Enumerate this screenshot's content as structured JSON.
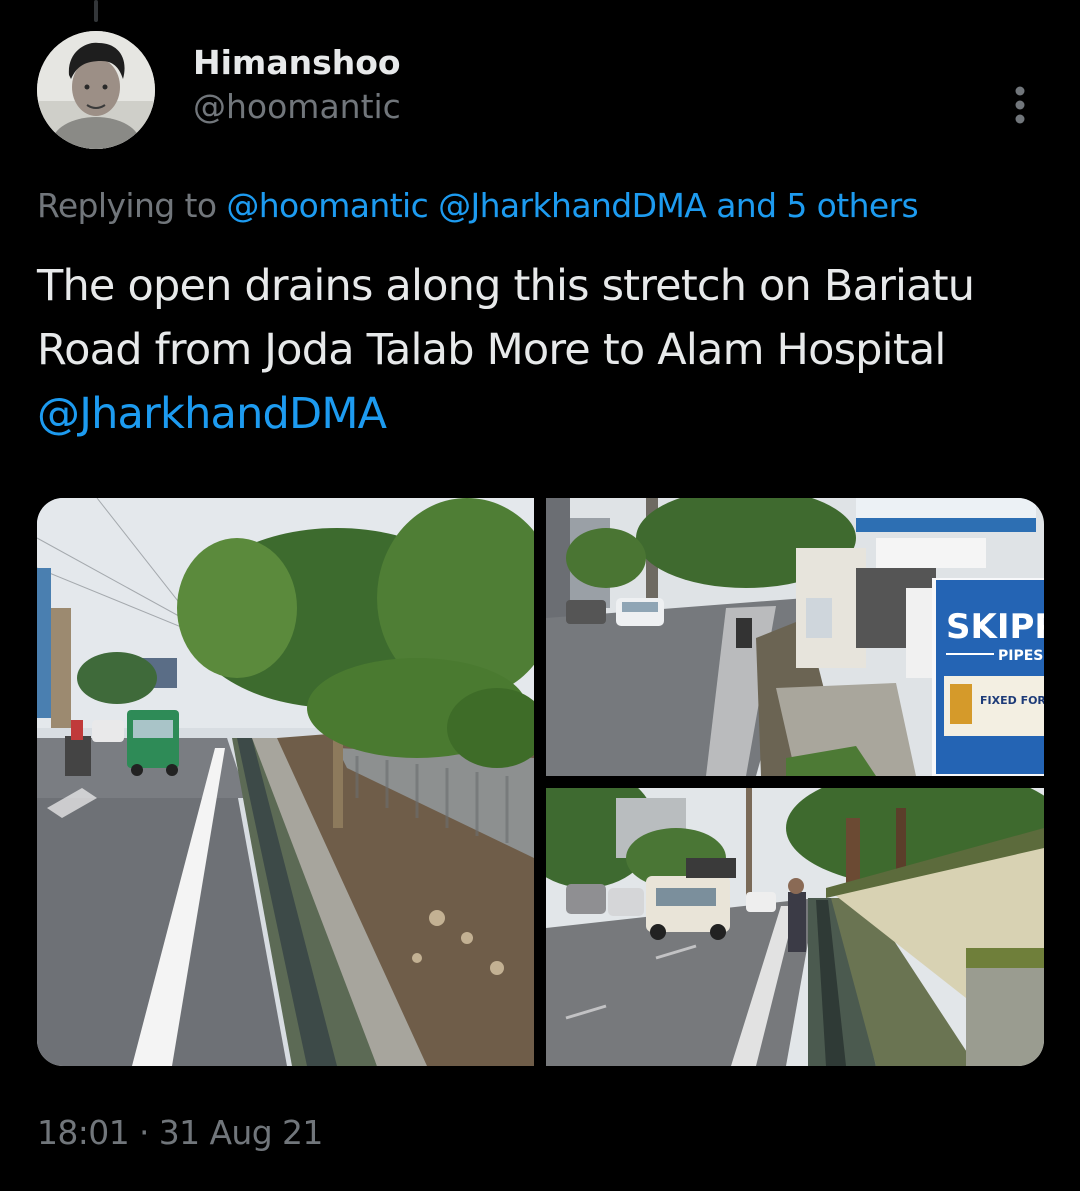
{
  "tweet": {
    "author": {
      "display_name": "Himanshoo",
      "handle": "@hoomantic"
    },
    "more_icon": "more-vertical-icon",
    "reply_context": {
      "prefix": "Replying to",
      "mention_1": "@hoomantic",
      "mention_2": "@JharkhandDMA",
      "others": "and 5 others"
    },
    "text": {
      "line_1": "The open drains along this stretch on Bariatu",
      "line_2": "Road from Joda Talab More to Alam Hospital",
      "mention": "@JharkhandDMA"
    },
    "media": {
      "photo_3_sign_brand": "SKIPP",
      "photo_3_sign_sub": "PIPES",
      "photo_3_sign_tag": "FIXED FOR LIF"
    },
    "meta": {
      "time": "18:01",
      "separator": "·",
      "date": "31 Aug 21"
    }
  },
  "colors": {
    "background": "#000000",
    "text_primary": "#e7e9ea",
    "text_secondary": "#71767b",
    "link": "#1d9bf0"
  }
}
